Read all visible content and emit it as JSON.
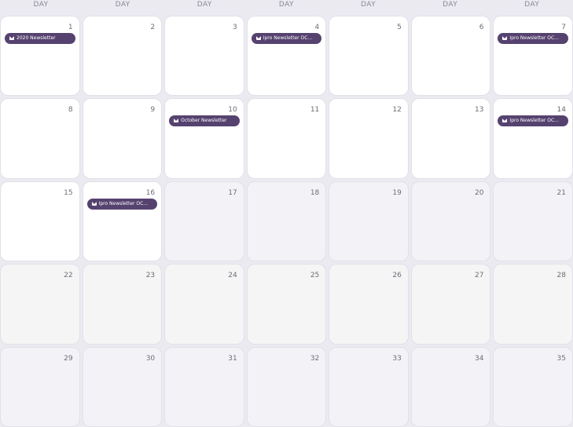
{
  "header": [
    "DAY",
    "DAY",
    "DAY",
    "DAY",
    "DAY",
    "DAY",
    "DAY"
  ],
  "days": [
    {
      "n": "1",
      "state": "in",
      "event": "2020 Newsletter"
    },
    {
      "n": "2",
      "state": "in"
    },
    {
      "n": "3",
      "state": "in"
    },
    {
      "n": "4",
      "state": "in",
      "event": "Ipro Newsletter OC..."
    },
    {
      "n": "5",
      "state": "in"
    },
    {
      "n": "6",
      "state": "in"
    },
    {
      "n": "7",
      "state": "in",
      "event": "Ipro Newsletter OC..."
    },
    {
      "n": "8",
      "state": "in"
    },
    {
      "n": "9",
      "state": "in"
    },
    {
      "n": "10",
      "state": "in",
      "event": "October Newsletter"
    },
    {
      "n": "11",
      "state": "in"
    },
    {
      "n": "12",
      "state": "in"
    },
    {
      "n": "13",
      "state": "in"
    },
    {
      "n": "14",
      "state": "in",
      "event": "Ipro Newsletter OC..."
    },
    {
      "n": "15",
      "state": "in"
    },
    {
      "n": "16",
      "state": "in",
      "event": "Ipro Newsletter OC..."
    },
    {
      "n": "17",
      "state": "out"
    },
    {
      "n": "18",
      "state": "out"
    },
    {
      "n": "19",
      "state": "out"
    },
    {
      "n": "20",
      "state": "out"
    },
    {
      "n": "21",
      "state": "out"
    },
    {
      "n": "22",
      "state": "grey"
    },
    {
      "n": "23",
      "state": "grey"
    },
    {
      "n": "24",
      "state": "grey"
    },
    {
      "n": "25",
      "state": "grey"
    },
    {
      "n": "26",
      "state": "grey"
    },
    {
      "n": "27",
      "state": "grey"
    },
    {
      "n": "28",
      "state": "grey"
    },
    {
      "n": "29",
      "state": "out"
    },
    {
      "n": "30",
      "state": "out"
    },
    {
      "n": "31",
      "state": "out"
    },
    {
      "n": "32",
      "state": "out"
    },
    {
      "n": "33",
      "state": "out"
    },
    {
      "n": "34",
      "state": "out"
    },
    {
      "n": "35",
      "state": "out"
    }
  ],
  "colors": {
    "event_bg": "#56426f",
    "in_bg": "#ffffff",
    "out_bg": "#f3f3f7",
    "grey_bg": "#f5f5f5"
  }
}
